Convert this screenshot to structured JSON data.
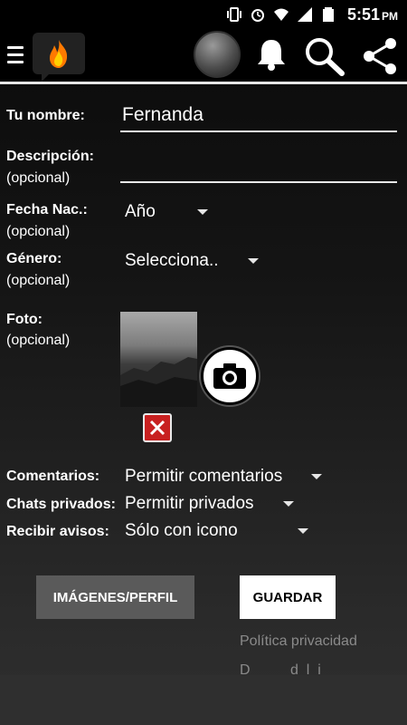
{
  "status_bar": {
    "time": "5:51",
    "ampm": "PM",
    "icons": [
      "vibrate-icon",
      "alarm-icon",
      "wifi-icon",
      "signal-icon",
      "battery-icon"
    ]
  },
  "app_bar": {
    "icons": [
      "menu-icon",
      "fire-logo-icon",
      "profile-avatar",
      "bell-icon",
      "search-icon",
      "share-icon"
    ]
  },
  "form": {
    "name_label": "Tu nombre:",
    "name_value": "Fernanda",
    "description_label": "Descripción:",
    "description_sub": "(opcional)",
    "description_value": "",
    "birth_label": "Fecha Nac.:",
    "birth_sub": "(opcional)",
    "birth_value": "Año",
    "gender_label": "Género:",
    "gender_sub": "(opcional)",
    "gender_value": "Selecciona..",
    "photo_label": "Foto:",
    "photo_sub": "(opcional)",
    "comments_label": "Comentarios:",
    "comments_value": "Permitir comentarios",
    "chats_label": "Chats privados:",
    "chats_value": "Permitir privados",
    "notices_label": "Recibir avisos:",
    "notices_value": "Sólo con icono"
  },
  "buttons": {
    "images_profile": "IMÁGENES/PERFIL",
    "save": "GUARDAR"
  },
  "links": {
    "privacy": "Política privacidad",
    "partial": "D          d  l  i"
  },
  "colors": {
    "background": "#111111",
    "delete_red": "#c82020",
    "gray_button": "#5a5a5a",
    "link_gray": "#8a8a8a"
  }
}
